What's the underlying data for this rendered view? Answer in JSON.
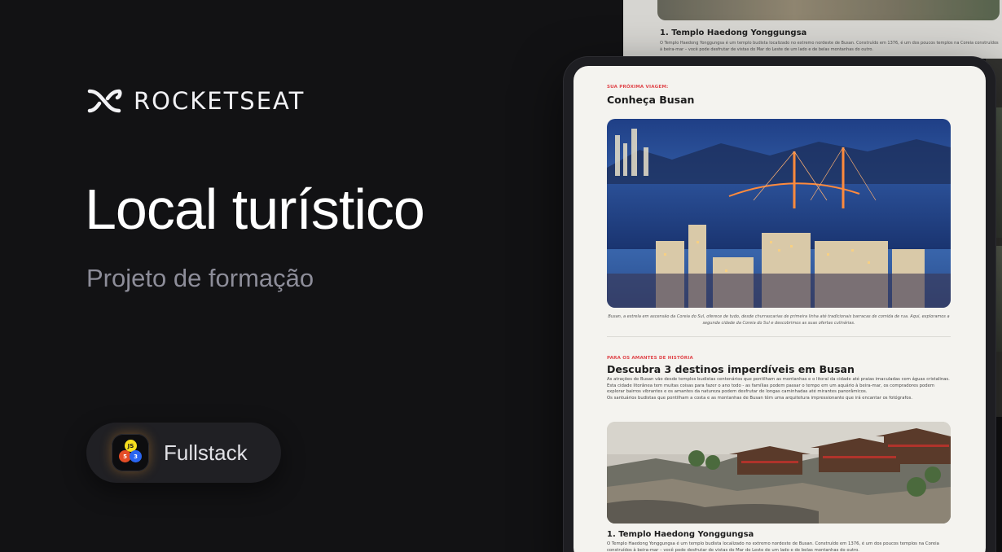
{
  "brand": {
    "name": "ROCKETSEAT"
  },
  "hero": {
    "title": "Local turístico",
    "subtitle": "Projeto de formação"
  },
  "badge": {
    "label": "Fullstack",
    "icons": [
      "JS",
      "5",
      "3"
    ]
  },
  "colors": {
    "background": "#121214",
    "accent": "#e0454a",
    "badge": "#202024",
    "muted": "#8d8d99"
  },
  "background_page": {
    "heading": "1. Templo Haedong Yonggungsa",
    "text": "O Templo Haedong Yonggungsa é um templo budista localizado no extremo nordeste de Busan. Construído em 1376, é um dos poucos templos na Coreia construídos à beira-mar – você pode desfrutar de vistas do Mar do Leste de um lado e de belas montanhas do outro."
  },
  "article": {
    "section1": {
      "eyebrow": "SUA PRÓXIMA VIAGEM:",
      "title": "Conheça Busan",
      "caption": "Busan, a estrela em ascensão da Coreia do Sul, oferece de tudo, desde churrascarias de primeira linha até tradicionais barracas de comida de rua. Aqui, exploramos a segunda cidade da Coreia do Sul e descobrimos as suas ofertas culinárias."
    },
    "section2": {
      "eyebrow": "PARA OS AMANTES DE HISTÓRIA",
      "title": "Descubra 3 destinos imperdíveis em Busan",
      "paragraph1": "As atrações de Busan vão desde templos budistas centenários que pontilham as montanhas e o litoral da cidade até praias imaculadas com águas cristalinas. Esta cidade litorânea tem muitas coisas para fazer o ano todo - as famílias podem passar o tempo em um aquário à beira-mar, os compradores podem explorar bairros vibrantes e os amantes da natureza podem desfrutar de longas caminhadas até mirantes panorâmicos.",
      "paragraph2": "Os santuários budistas que pontilham a costa e as montanhas de Busan têm uma arquitetura impressionante que irá encantar os fotógrafos."
    },
    "destination1": {
      "title": "1. Templo Haedong Yonggungsa",
      "text": "O Templo Haedong Yonggungsa é um templo budista localizado no extremo nordeste de Busan. Construído em 1376, é um dos poucos templos na Coreia construídos à beira-mar – você pode desfrutar de vistas do Mar do Leste de um lado e de belas montanhas do outro."
    }
  }
}
